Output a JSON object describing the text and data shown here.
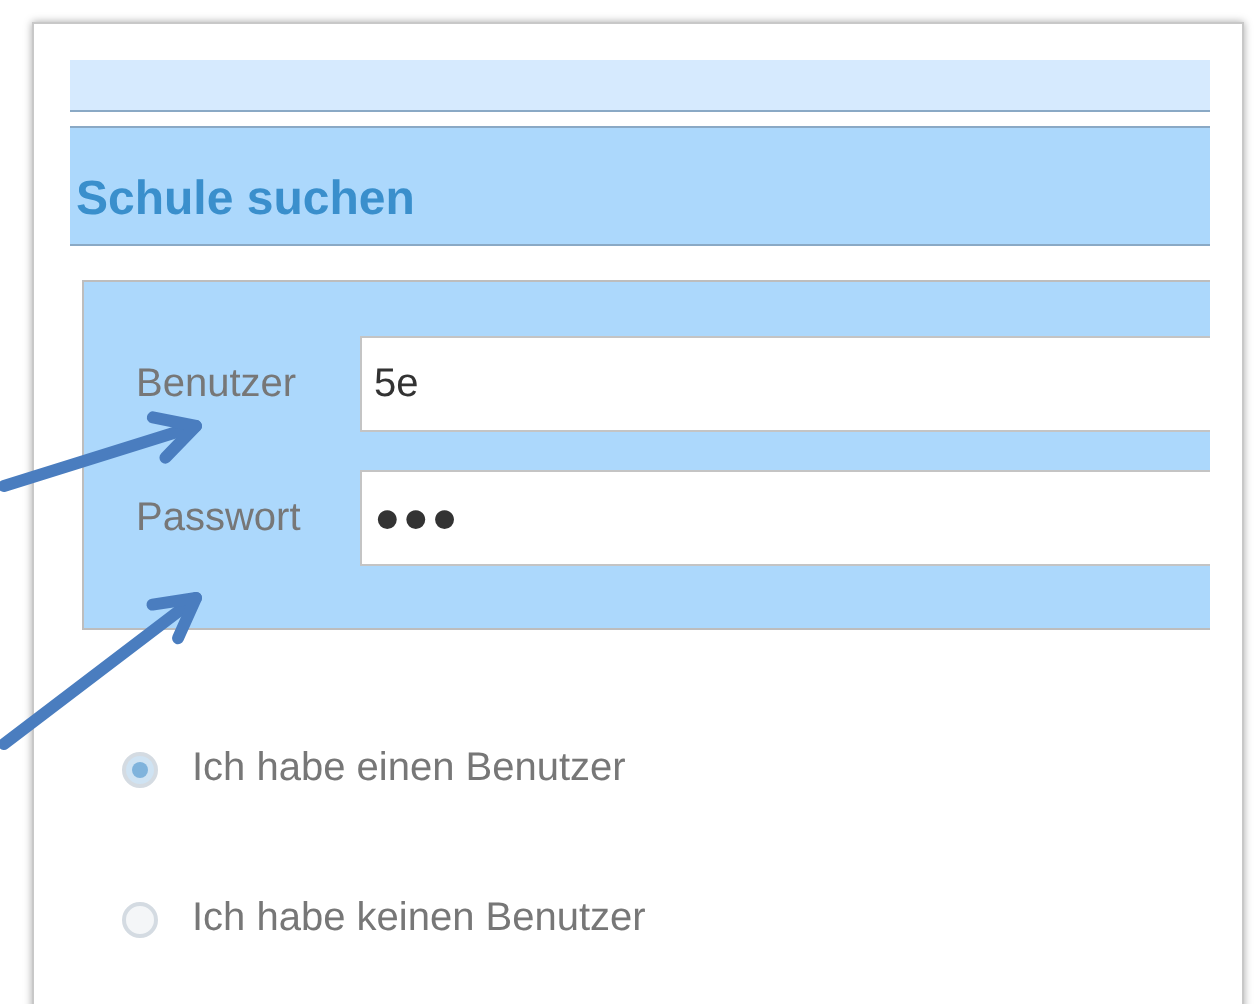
{
  "heading": "Schule suchen",
  "fields": [
    {
      "label": "Benutzer",
      "value": "5e",
      "kind": "text"
    },
    {
      "label": "Passwort",
      "value": "●●●",
      "kind": "password"
    }
  ],
  "options": [
    {
      "label": "Ich habe einen Benutzer",
      "selected": true
    },
    {
      "label": "Ich habe keinen Benutzer",
      "selected": false
    }
  ]
}
